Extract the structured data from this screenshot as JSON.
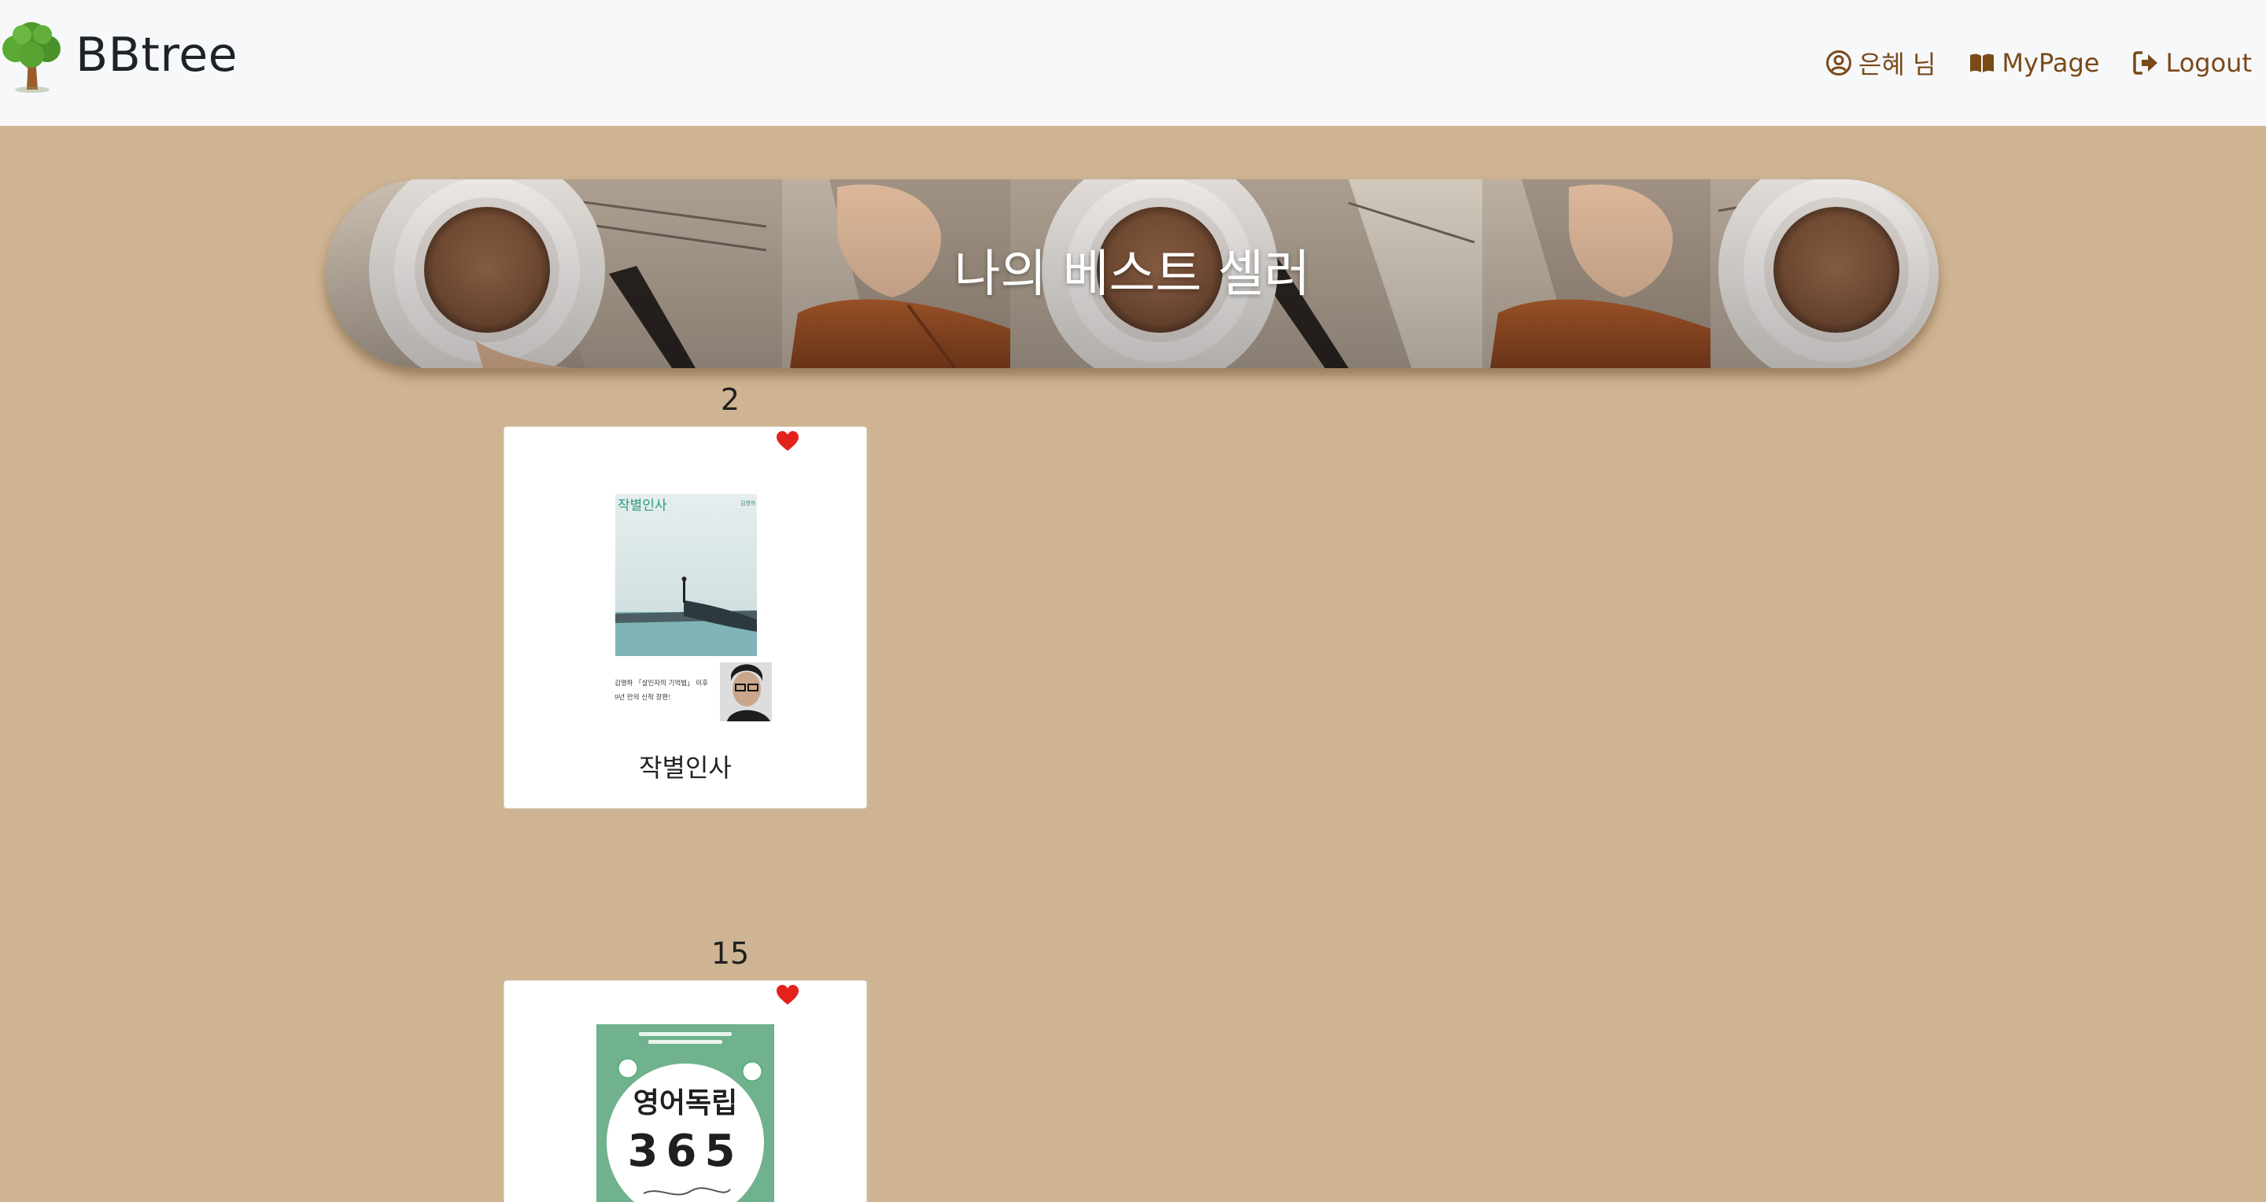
{
  "header": {
    "brand": "BBtree",
    "nav": [
      {
        "label": "은혜 님",
        "icon": "user-circle-icon"
      },
      {
        "label": "MyPage",
        "icon": "book-open-icon"
      },
      {
        "label": "Logout",
        "icon": "sign-out-icon"
      }
    ]
  },
  "banner": {
    "title": "나의 베스트 셀러"
  },
  "books": [
    {
      "rank": "2",
      "title": "작별인사",
      "liked": true,
      "cover_text": {
        "title": "작별인사",
        "author": "김영하",
        "blurb1": "김영하 「살인자의 기억법」 이후",
        "blurb2": "9년 만의 신작 장편!"
      }
    },
    {
      "rank": "15",
      "title": "",
      "liked": true,
      "cover_text": {
        "title": "영어독립",
        "number": "365"
      }
    }
  ],
  "colors": {
    "page_bg": "#ceb492",
    "nav_bg": "#f7f8fa",
    "nav_link": "#7a4a18",
    "heart": "#e3221b",
    "card_bg": "#ffffff"
  }
}
